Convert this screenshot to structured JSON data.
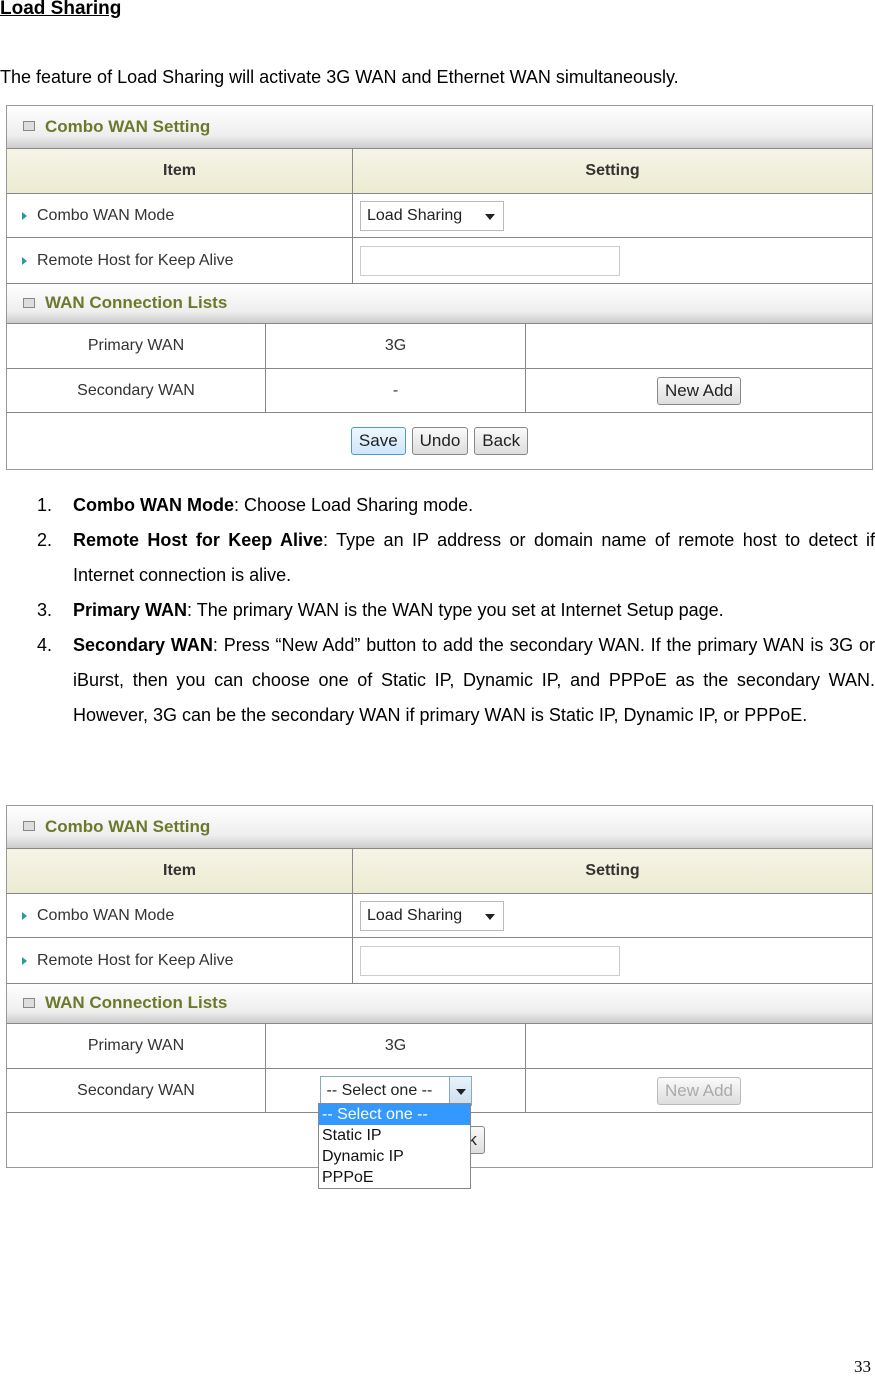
{
  "heading": "Load Sharing",
  "intro": "The feature of Load Sharing will activate 3G WAN and Ethernet WAN simultaneously.",
  "panel": {
    "title": "Combo WAN Setting",
    "col_item": "Item",
    "col_setting": "Setting",
    "mode_label": "Combo WAN Mode",
    "mode_value": "Load Sharing",
    "remote_label": "Remote Host for Keep Alive",
    "remote_value": "",
    "lists_title": "WAN Connection Lists",
    "primary_label": "Primary WAN",
    "primary_value": "3G",
    "secondary_label": "Secondary WAN",
    "secondary_value": "-",
    "new_add": "New Add",
    "save": "Save",
    "undo": "Undo",
    "back": "Back"
  },
  "panel2": {
    "select_value": "-- Select one --",
    "options": [
      "-- Select one --",
      "Static IP",
      "Dynamic IP",
      "PPPoE"
    ]
  },
  "list": [
    {
      "num": "1.",
      "term": "Combo WAN Mode",
      "text": ": Choose Load Sharing mode."
    },
    {
      "num": "2.",
      "term": "Remote Host for Keep Alive",
      "text": ": Type an IP address or domain name of remote host to detect if Internet connection is alive."
    },
    {
      "num": "3.",
      "term": "Primary WAN",
      "text": ": The primary WAN is the WAN type you set at Internet Setup page."
    },
    {
      "num": "4.",
      "term": "Secondary WAN",
      "text": ": Press “New Add” button to add the secondary WAN. If the primary WAN is 3G or iBurst, then you can choose one of Static IP, Dynamic IP, and PPPoE as the secondary WAN. However, 3G can be the secondary WAN if primary WAN is Static IP, Dynamic IP, or PPPoE."
    }
  ],
  "page_number": "33"
}
